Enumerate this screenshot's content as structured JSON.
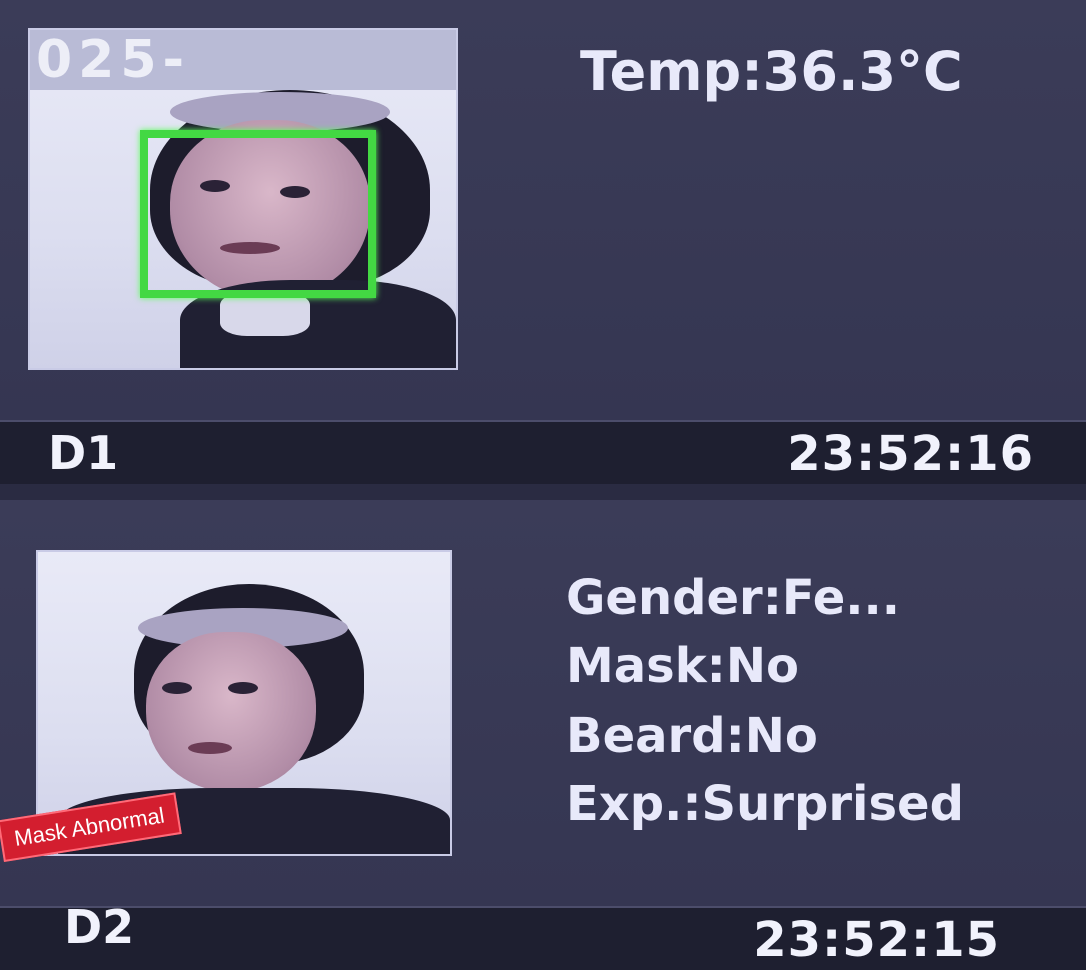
{
  "cards": [
    {
      "camera": "D1",
      "time": "23:52:16",
      "temperature": "Temp:36.3°C",
      "sign_text": "025-",
      "photo_icon": "face-capture-photo"
    },
    {
      "camera": "D2",
      "time": "23:52:15",
      "attributes": {
        "gender": "Gender:Fe...",
        "mask": "Mask:No",
        "beard": "Beard:No",
        "expression": "Exp.:Surprised"
      },
      "alert_badge": "Mask Abnormal",
      "photo_icon": "face-capture-photo"
    }
  ],
  "colors": {
    "face_box": "#43d843",
    "alert": "#d31e2f",
    "panel_bg": "#3b3c58",
    "footer_bg": "#1e1f30",
    "text": "#e8e9fa"
  }
}
